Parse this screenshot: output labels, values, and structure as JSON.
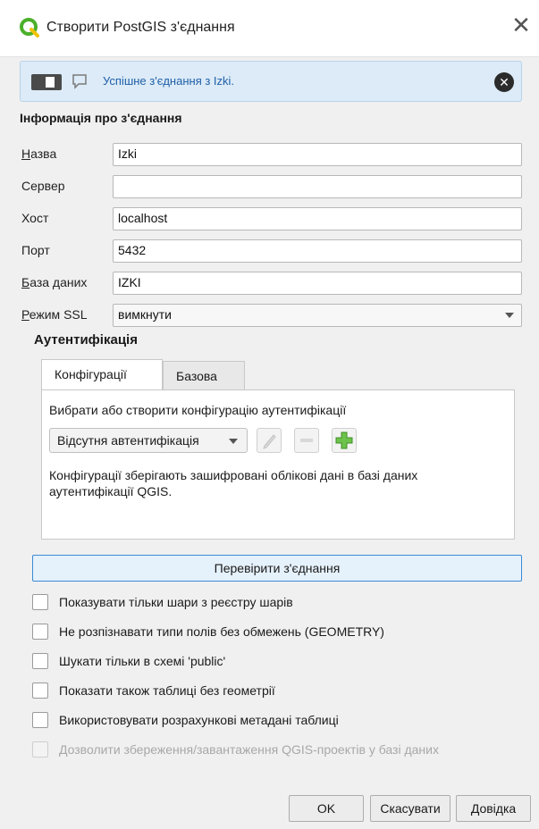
{
  "window": {
    "title": "Створити PostGIS з'єднання",
    "icon": "qgis-logo-icon",
    "close_glyph": "✕"
  },
  "message_bar": {
    "text": "Успішне з'єднання з Izki.",
    "close_glyph": "✕"
  },
  "connection_info": {
    "section_title": "Інформація про з'єднання",
    "fields": {
      "name": {
        "label": "Назва",
        "value": "Izki"
      },
      "service": {
        "label": "Сервер",
        "value": ""
      },
      "host": {
        "label": "Хост",
        "value": "localhost"
      },
      "port": {
        "label": "Порт",
        "value": "5432"
      },
      "database": {
        "label": "База даних",
        "value": "IZKI"
      },
      "ssl_mode": {
        "label": "Режим SSL",
        "value": "вимкнути"
      }
    }
  },
  "authentication": {
    "title": "Аутентифікація",
    "tabs": [
      {
        "label": "Конфігурації",
        "active": true
      },
      {
        "label": "Базова",
        "active": false
      }
    ],
    "prompt": "Вибрати або створити конфігурацію аутентифікації",
    "config_select": "Відсутня автентифікація",
    "description": "Конфігурації зберігають зашифровані облікові дані в базі даних аутентифікації QGIS."
  },
  "test_button": "Перевірити з'єднання",
  "options": [
    {
      "label": "Показувати тільки шари з реєстру шарів",
      "checked": false,
      "enabled": true
    },
    {
      "label": "Не розпізнавати типи полів без обмежень (GEOMETRY)",
      "checked": false,
      "enabled": true
    },
    {
      "label": "Шукати тільки в схемі 'public'",
      "checked": false,
      "enabled": true
    },
    {
      "label": "Показати також таблиці без геометрії",
      "checked": false,
      "enabled": true
    },
    {
      "label": "Використовувати розрахункові метадані таблиці",
      "checked": false,
      "enabled": true
    },
    {
      "label": "Дозволити збереження/завантаження QGIS-проектів у базі даних",
      "checked": false,
      "enabled": false
    }
  ],
  "footer": {
    "ok": "OK",
    "cancel": "Скасувати",
    "help": "Довідка"
  },
  "colors": {
    "message_bg": "#dcebf7",
    "message_text": "#1f5fa8",
    "qgis_green": "#4caf2a",
    "qgis_yellow": "#f2c200"
  }
}
